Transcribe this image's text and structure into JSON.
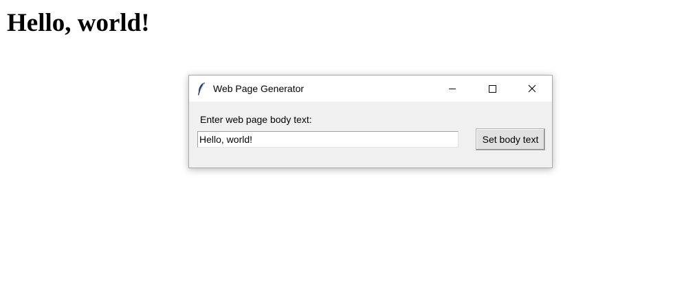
{
  "page": {
    "heading": "Hello, world!"
  },
  "window": {
    "title": "Web Page Generator",
    "controls": {
      "minimize_icon": "minimize-icon",
      "maximize_icon": "maximize-icon",
      "close_icon": "close-icon"
    },
    "app_icon": "feather-icon",
    "form": {
      "label": "Enter web page body text:",
      "input_value": "Hello, world!",
      "button_label": "Set body text"
    }
  },
  "colors": {
    "window_body": "#f0f0f0",
    "titlebar": "#ffffff",
    "button_face": "#e1e1e1"
  }
}
